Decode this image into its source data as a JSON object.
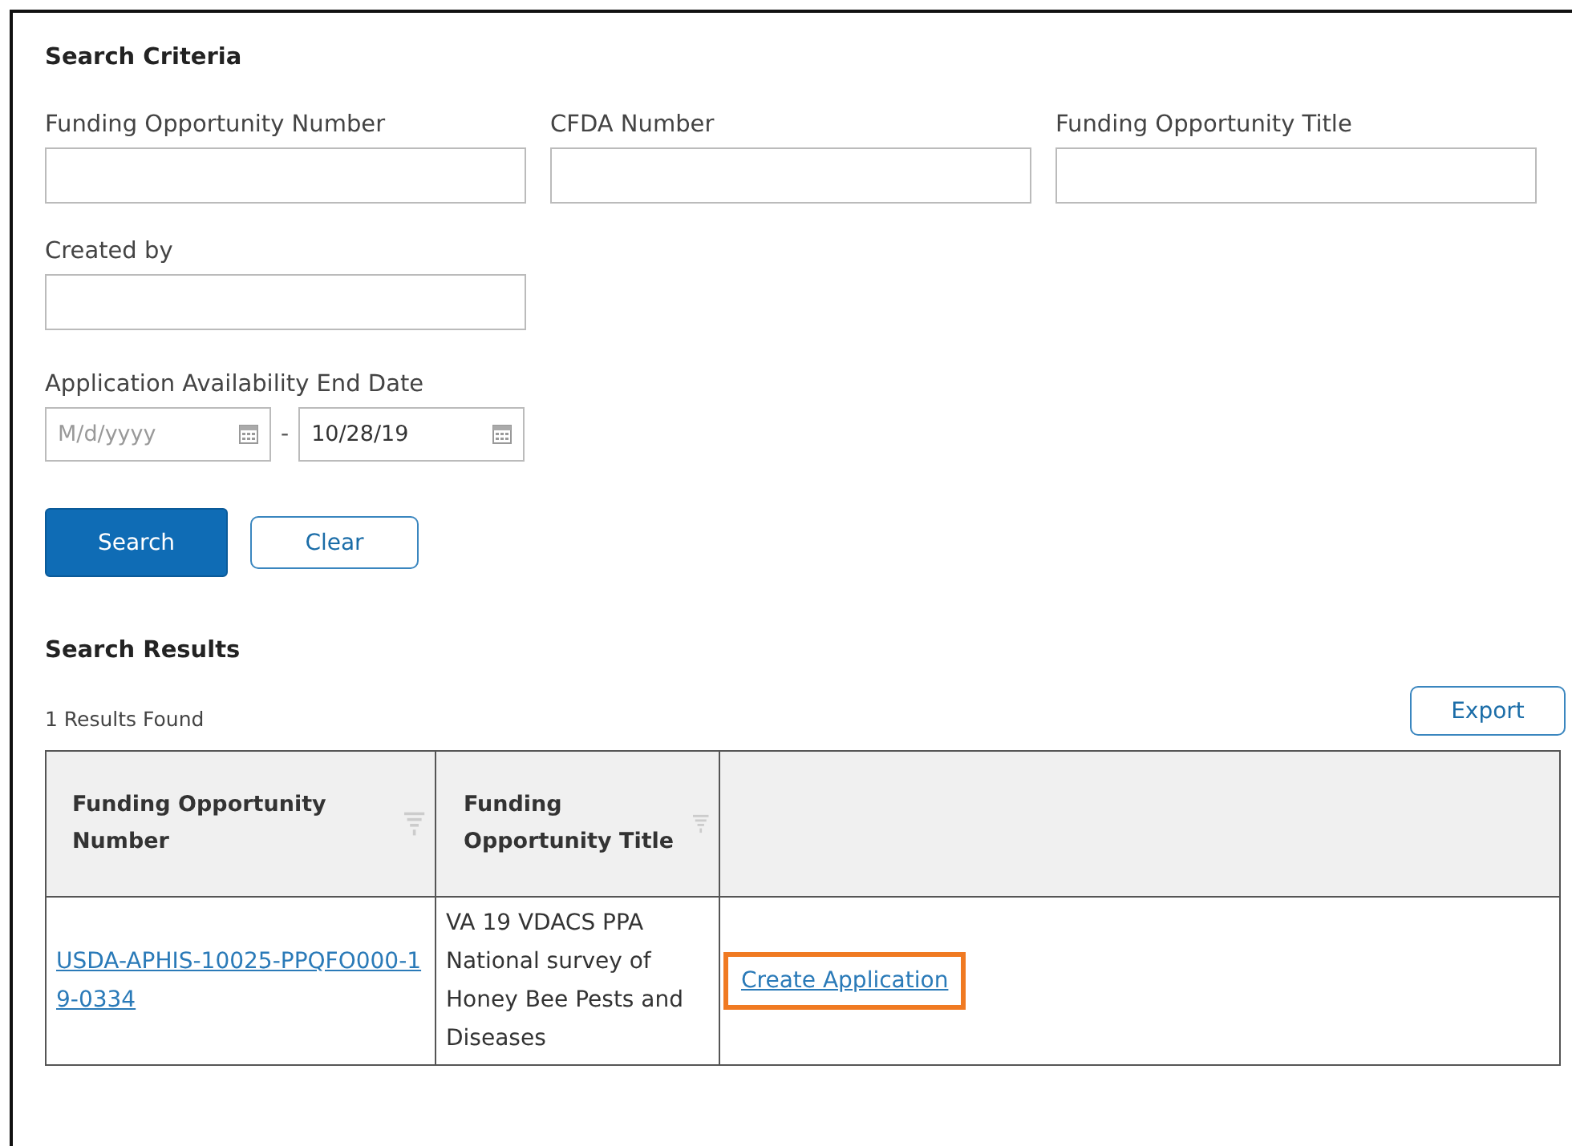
{
  "criteria": {
    "title": "Search Criteria",
    "fields": [
      {
        "label": "Funding Opportunity Number"
      },
      {
        "label": "CFDA Number"
      },
      {
        "label": "Funding Opportunity Title"
      },
      {
        "label": "Created by"
      }
    ],
    "date_range": {
      "label": "Application Availability End Date",
      "from": {
        "placeholder": "M/d/yyyy"
      },
      "separator": "-",
      "to": {
        "value": "10/28/19"
      }
    },
    "buttons": [
      {
        "label": "Search",
        "kind": "primary"
      },
      {
        "label": "Clear",
        "kind": "secondary"
      }
    ]
  },
  "results": {
    "title": "Search Results",
    "count": "1 Results Found",
    "export": "Export",
    "table": {
      "columns": [
        {
          "label": "Funding Opportunity Number",
          "filter": true
        },
        {
          "label": "Funding Opportunity Title",
          "filter": true
        },
        {
          "filter": false
        }
      ],
      "rows": [
        {
          "number": "USDA-APHIS-10025-PPQFO000-19-0334",
          "title": "VA 19 VDACS PPA National survey of Honey Bee Pests and Diseases",
          "action": "Create Application",
          "highlighted": true
        }
      ]
    }
  }
}
